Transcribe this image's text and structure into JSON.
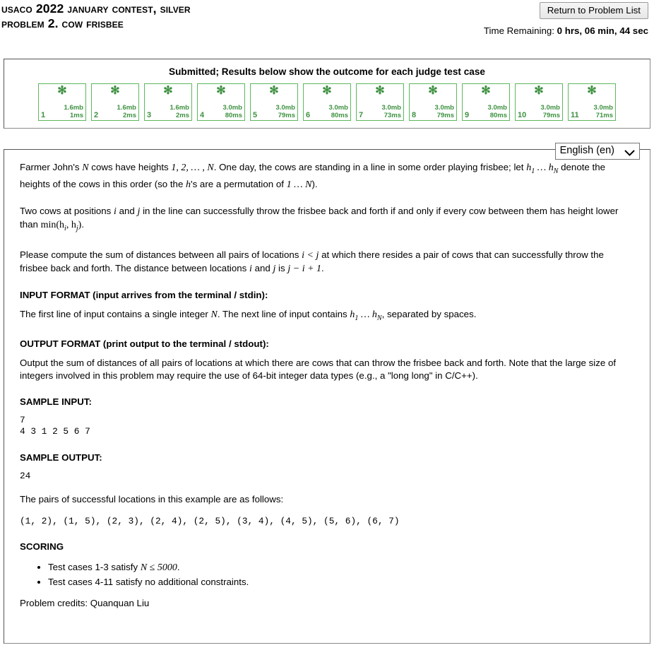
{
  "header": {
    "contest_title": "USACO 2022 January Contest, Silver",
    "problem_title": "Problem 2. Cow Frisbee",
    "return_button": "Return to Problem List",
    "time_label": "Time Remaining:",
    "time_value": "0 hrs, 06 min, 44 sec"
  },
  "results": {
    "status_text": "Submitted; Results below show the outcome for each judge test case",
    "marker": "✻",
    "accent_color": "#3d9140",
    "border_color": "#5cb85c",
    "cases": [
      {
        "num": "1",
        "memory": "1.6mb",
        "time": "1ms"
      },
      {
        "num": "2",
        "memory": "1.6mb",
        "time": "2ms"
      },
      {
        "num": "3",
        "memory": "1.6mb",
        "time": "2ms"
      },
      {
        "num": "4",
        "memory": "3.0mb",
        "time": "80ms"
      },
      {
        "num": "5",
        "memory": "3.0mb",
        "time": "79ms"
      },
      {
        "num": "6",
        "memory": "3.0mb",
        "time": "80ms"
      },
      {
        "num": "7",
        "memory": "3.0mb",
        "time": "73ms"
      },
      {
        "num": "8",
        "memory": "3.0mb",
        "time": "79ms"
      },
      {
        "num": "9",
        "memory": "3.0mb",
        "time": "80ms"
      },
      {
        "num": "10",
        "memory": "3.0mb",
        "time": "79ms"
      },
      {
        "num": "11",
        "memory": "3.0mb",
        "time": "71ms"
      }
    ]
  },
  "language": {
    "selected": "English (en)",
    "options": [
      "English (en)"
    ]
  },
  "problem": {
    "para1_a": "Farmer John's ",
    "para1_n1": "N",
    "para1_b": " cows have heights ",
    "para1_m1": "1, 2, … , N",
    "para1_c": ". One day, the cows are standing in a line in some order playing frisbee; let ",
    "para1_m2": "h",
    "para1_m2sub": "1",
    "para1_m3": " … h",
    "para1_m3sub": "N",
    "para1_d": " denote the heights of the cows in this order (so the ",
    "para1_h": "h",
    "para1_e": "'s are a permutation of ",
    "para1_m4": "1 … N",
    "para1_f": ").",
    "para2_a": "Two cows at positions ",
    "para2_i": "i",
    "para2_b": " and ",
    "para2_j": "j",
    "para2_c": " in the line can successfully throw the frisbee back and forth if and only if every cow between them has height lower than ",
    "para2_min": "min(h",
    "para2_minsub1": "i",
    "para2_min2": ", h",
    "para2_minsub2": "j",
    "para2_min3": ")",
    "para2_d": ".",
    "para3_a": "Please compute the sum of distances between all pairs of locations ",
    "para3_m": "i < j",
    "para3_b": " at which there resides a pair of cows that can successfully throw the frisbee back and forth. The distance between locations ",
    "para3_i": "i",
    "para3_c": " and ",
    "para3_j": "j",
    "para3_d": " is ",
    "para3_m2": "j − i + 1",
    "para3_e": ".",
    "input_format_head": "INPUT FORMAT (input arrives from the terminal / stdin):",
    "input_format_a": "The first line of input contains a single integer ",
    "input_format_n": "N",
    "input_format_b": ". The next line of input contains ",
    "input_format_h1": "h",
    "input_format_h1sub": "1",
    "input_format_h2": " … h",
    "input_format_h2sub": "N",
    "input_format_c": ", separated by spaces.",
    "output_format_head": "OUTPUT FORMAT (print output to the terminal / stdout):",
    "output_format_text": "Output the sum of distances of all pairs of locations at which there are cows that can throw the frisbee back and forth. Note that the large size of integers involved in this problem may require the use of 64-bit integer data types (e.g., a \"long long\" in C/C++).",
    "sample_input_head": "SAMPLE INPUT:",
    "sample_input_body": "7\n4 3 1 2 5 6 7",
    "sample_output_head": "SAMPLE OUTPUT:",
    "sample_output_body": "24",
    "pairs_intro": "The pairs of successful locations in this example are as follows:",
    "pairs_body": "(1, 2), (1, 5), (2, 3), (2, 4), (2, 5), (3, 4), (4, 5), (5, 6), (6, 7)",
    "scoring_head": "SCORING",
    "scoring_items": [
      {
        "pre": "Test cases 1-3 satisfy ",
        "math": "N ≤ 5000",
        "post": "."
      },
      {
        "pre": "Test cases 4-11 satisfy no additional constraints.",
        "math": "",
        "post": ""
      }
    ],
    "credits": "Problem credits: Quanquan Liu"
  }
}
